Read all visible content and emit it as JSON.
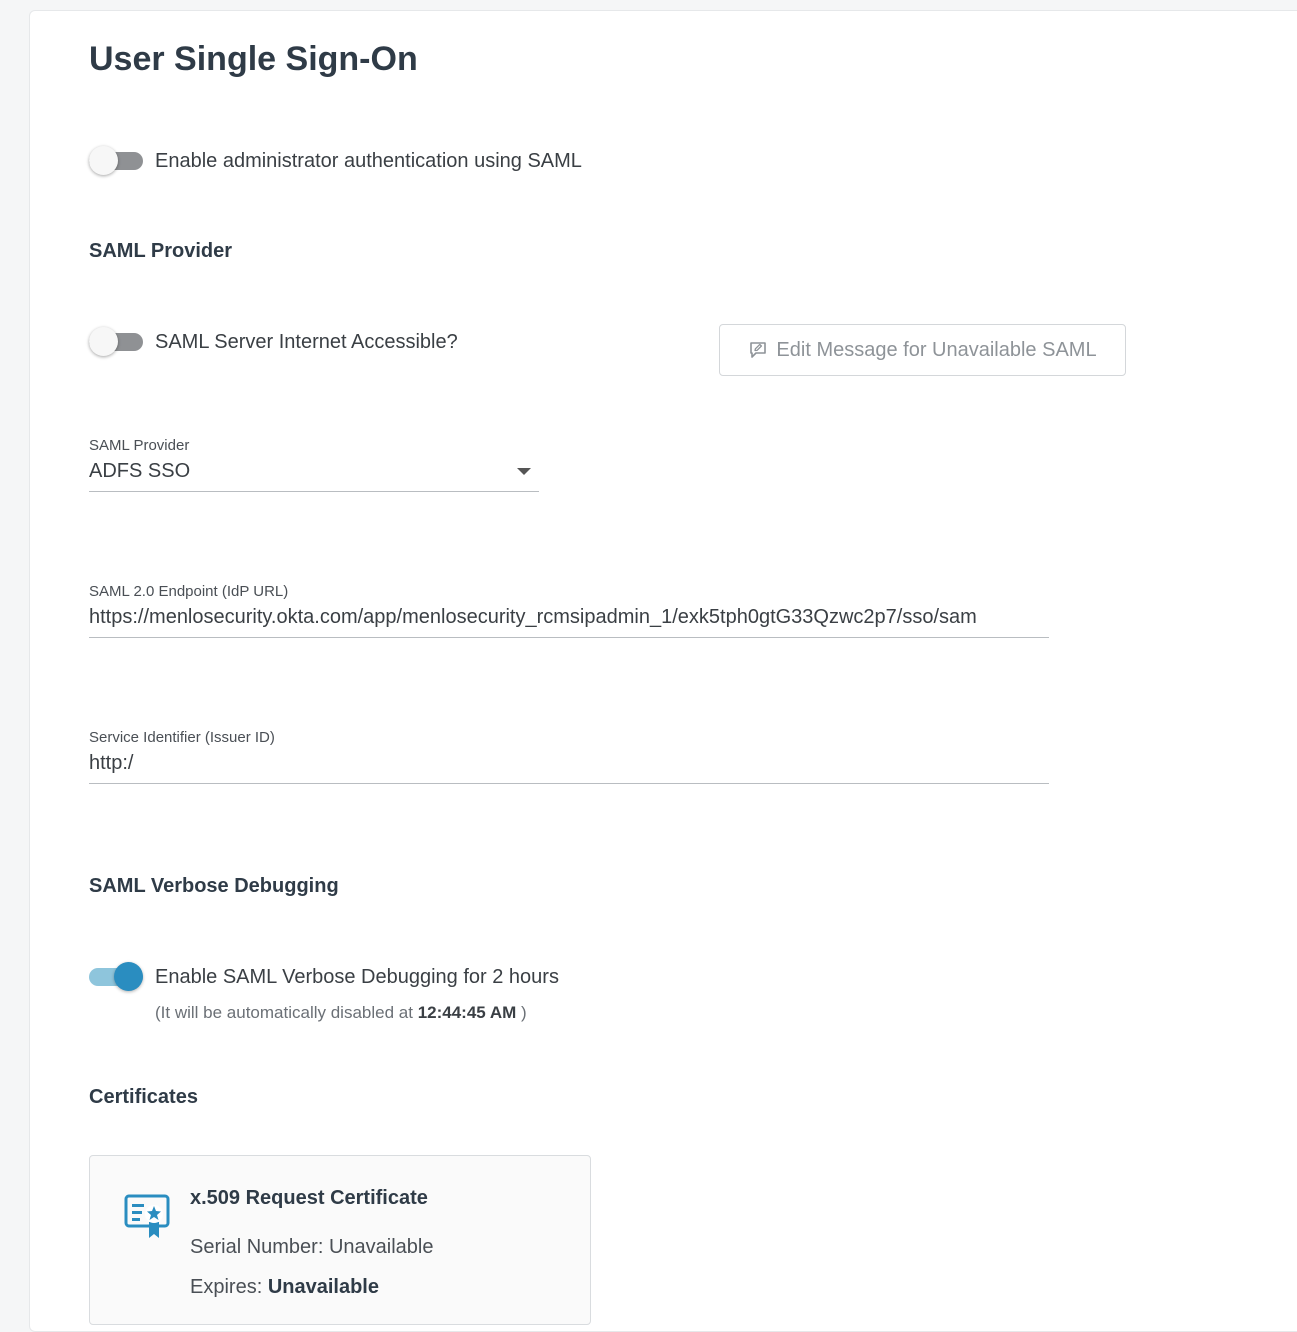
{
  "page": {
    "title": "User Single Sign-On"
  },
  "admin_auth": {
    "enabled": false,
    "label": "Enable administrator authentication using SAML"
  },
  "saml_provider_section": {
    "heading": "SAML Provider",
    "internet_accessible": {
      "enabled": false,
      "label": "SAML Server Internet Accessible?"
    },
    "edit_message_button": {
      "label": "Edit Message for Unavailable SAML",
      "icon": "comment-edit-icon"
    },
    "provider_select": {
      "label": "SAML Provider",
      "value": "ADFS SSO"
    },
    "endpoint": {
      "label": "SAML 2.0 Endpoint (IdP URL)",
      "value": "https://menlosecurity.okta.com/app/menlosecurity_rcmsipadmin_1/exk5tph0gtG33Qzwc2p7/sso/sam"
    },
    "issuer": {
      "label": "Service Identifier (Issuer ID)",
      "value": "http:/"
    }
  },
  "debugging_section": {
    "heading": "SAML Verbose Debugging",
    "toggle": {
      "enabled": true,
      "label": "Enable SAML Verbose Debugging for 2 hours"
    },
    "note_prefix": "(It will be automatically disabled at",
    "note_time": "12:44:45 AM",
    "note_suffix": ")"
  },
  "certificates_section": {
    "heading": "Certificates",
    "card": {
      "icon": "certificate-icon",
      "title": "x.509 Request Certificate",
      "serial_label": "Serial Number:",
      "serial_value": "Unavailable",
      "expires_label": "Expires:",
      "expires_value": "Unavailable"
    }
  },
  "colors": {
    "accent": "#2a8dc0",
    "toggle_off": "#8f9194",
    "heading": "#2f3b47"
  }
}
